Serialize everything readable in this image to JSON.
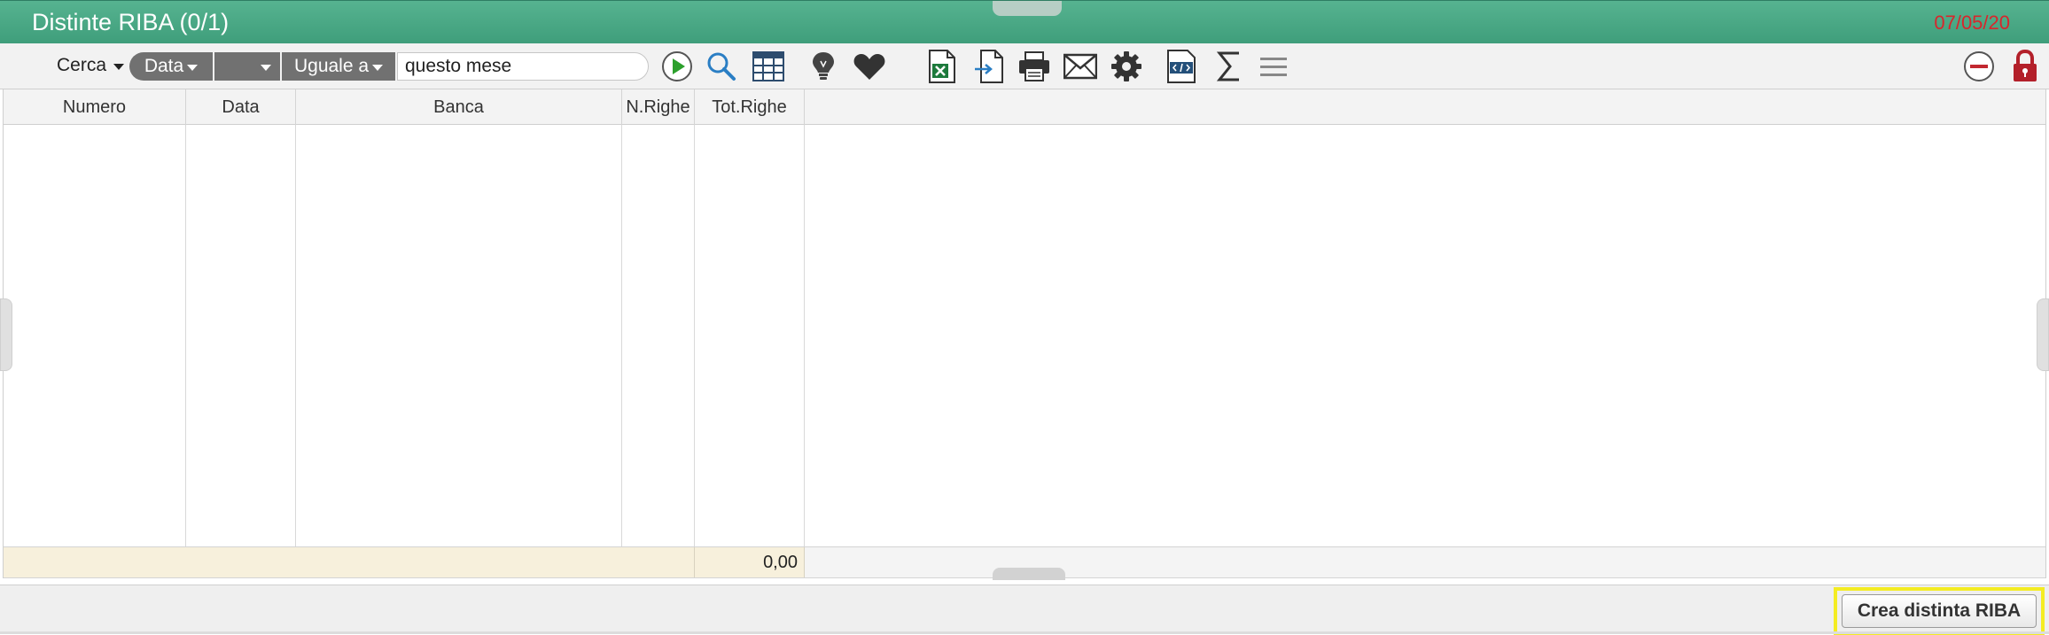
{
  "window": {
    "title": "Distinte RIBA (0/1)",
    "date": "07/05/20"
  },
  "toolbar": {
    "search_label": "Cerca",
    "field_value": "Data",
    "second_value": "",
    "operator_value": "Uguale a",
    "search_text": "questo mese",
    "icons": [
      "play-icon",
      "search-icon",
      "table-view-icon",
      "lightbulb-icon",
      "heart-icon",
      "excel-export-icon",
      "import-icon",
      "print-icon",
      "email-icon",
      "gear-icon",
      "code-icon",
      "sum-icon",
      "menu-icon",
      "remove-icon",
      "lock-icon"
    ]
  },
  "table": {
    "columns": [
      "Numero",
      "Data",
      "Banca",
      "N.Righe",
      "Tot.Righe"
    ],
    "rows": [],
    "footer_total": "0,00"
  },
  "footer": {
    "create_button_label": "Crea distinta RIBA"
  },
  "colors": {
    "titlebar": "#4aa985",
    "date_text": "#d8262c",
    "highlight": "#f4ec23",
    "play_green": "#2ca02c",
    "lock_red": "#b3202a"
  }
}
